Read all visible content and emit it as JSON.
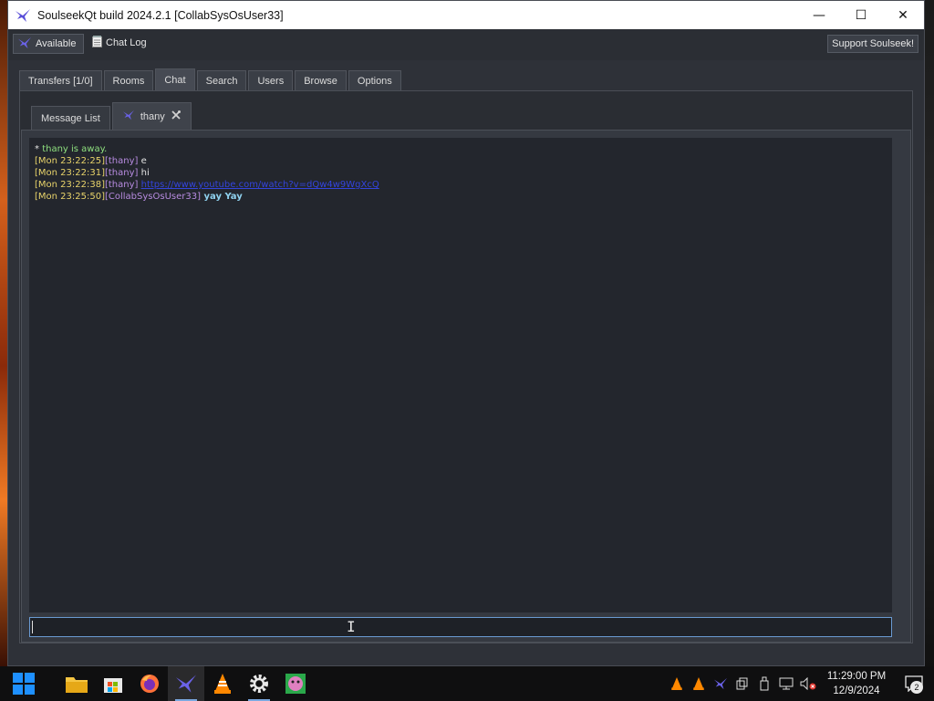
{
  "window": {
    "title": "SoulseekQt build 2024.2.1 [CollabSysOsUser33]",
    "controls": {
      "minimize": "—",
      "maximize": "☐",
      "close": "✕"
    }
  },
  "toolbar": {
    "status_label": "Available",
    "chatlog_label": "Chat Log",
    "support_label": "Support Soulseek!"
  },
  "main_tabs": [
    {
      "label": "Transfers [1/0]"
    },
    {
      "label": "Rooms"
    },
    {
      "label": "Chat",
      "active": true
    },
    {
      "label": "Search"
    },
    {
      "label": "Users"
    },
    {
      "label": "Browse"
    },
    {
      "label": "Options"
    }
  ],
  "chat_tabs": [
    {
      "label": "Message List"
    },
    {
      "label": "thany",
      "active": true
    }
  ],
  "chat": {
    "status_line": {
      "prefix": "* ",
      "text": "thany is away."
    },
    "messages": [
      {
        "time": "[Mon 23:22:25]",
        "user": "[thany]",
        "text": " e"
      },
      {
        "time": "[Mon 23:22:31]",
        "user": "[thany]",
        "text": " hi"
      },
      {
        "time": "[Mon 23:22:38]",
        "user": "[thany]",
        "link": "https://www.youtube.com/watch?v=dQw4w9WgXcQ"
      },
      {
        "time": "[Mon 23:25:50]",
        "user": "[CollabSysOsUser33]",
        "bold": " yay  Yay"
      }
    ],
    "input_value": ""
  },
  "taskbar": {
    "apps": [
      {
        "name": "windows-start-icon"
      },
      {
        "name": "file-explorer-icon"
      },
      {
        "name": "microsoft-store-icon"
      },
      {
        "name": "firefox-icon"
      },
      {
        "name": "soulseek-icon",
        "active": true
      },
      {
        "name": "vlc-icon"
      },
      {
        "name": "settings-icon"
      },
      {
        "name": "app-icon"
      }
    ],
    "clock": {
      "time": "11:29:00 PM",
      "date": "12/9/2024"
    },
    "notification_count": "2"
  },
  "colors": {
    "timestamp": "#e8d36a",
    "username": "#b78be0",
    "status": "#8fe07f",
    "link": "#3344dd",
    "own_message": "#8fd2ef"
  }
}
